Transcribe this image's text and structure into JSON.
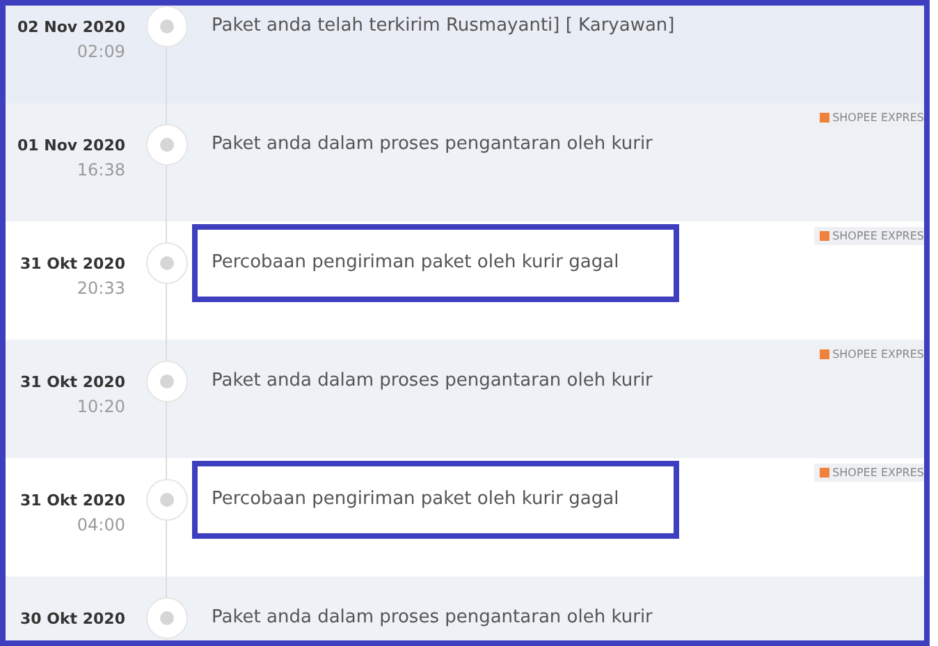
{
  "events": [
    {
      "date": "02 Nov 2020",
      "time": "02:09",
      "description": "Paket anda telah terkirim Rusmayanti] [ Karyawan]",
      "shaded": true,
      "highlighted": false
    },
    {
      "date": "01 Nov 2020",
      "time": "16:38",
      "description": "Paket anda dalam proses pengantaran oleh kurir",
      "courier": "SHOPEE EXPRES",
      "shaded": true,
      "highlighted": false
    },
    {
      "date": "31 Okt 2020",
      "time": "20:33",
      "description": "Percobaan pengiriman paket oleh kurir gagal",
      "courier": "SHOPEE EXPRES",
      "shaded": false,
      "highlighted": true
    },
    {
      "date": "31 Okt 2020",
      "time": "10:20",
      "description": "Paket anda dalam proses pengantaran oleh kurir",
      "courier": "SHOPEE EXPRES",
      "shaded": true,
      "highlighted": false
    },
    {
      "date": "31 Okt 2020",
      "time": "04:00",
      "description": "Percobaan pengiriman paket oleh kurir gagal",
      "courier": "SHOPEE EXPRES",
      "shaded": false,
      "highlighted": true
    },
    {
      "date": "30 Okt 2020",
      "description": "Paket anda dalam proses pengantaran oleh kurir",
      "shaded": true,
      "highlighted": false
    }
  ]
}
